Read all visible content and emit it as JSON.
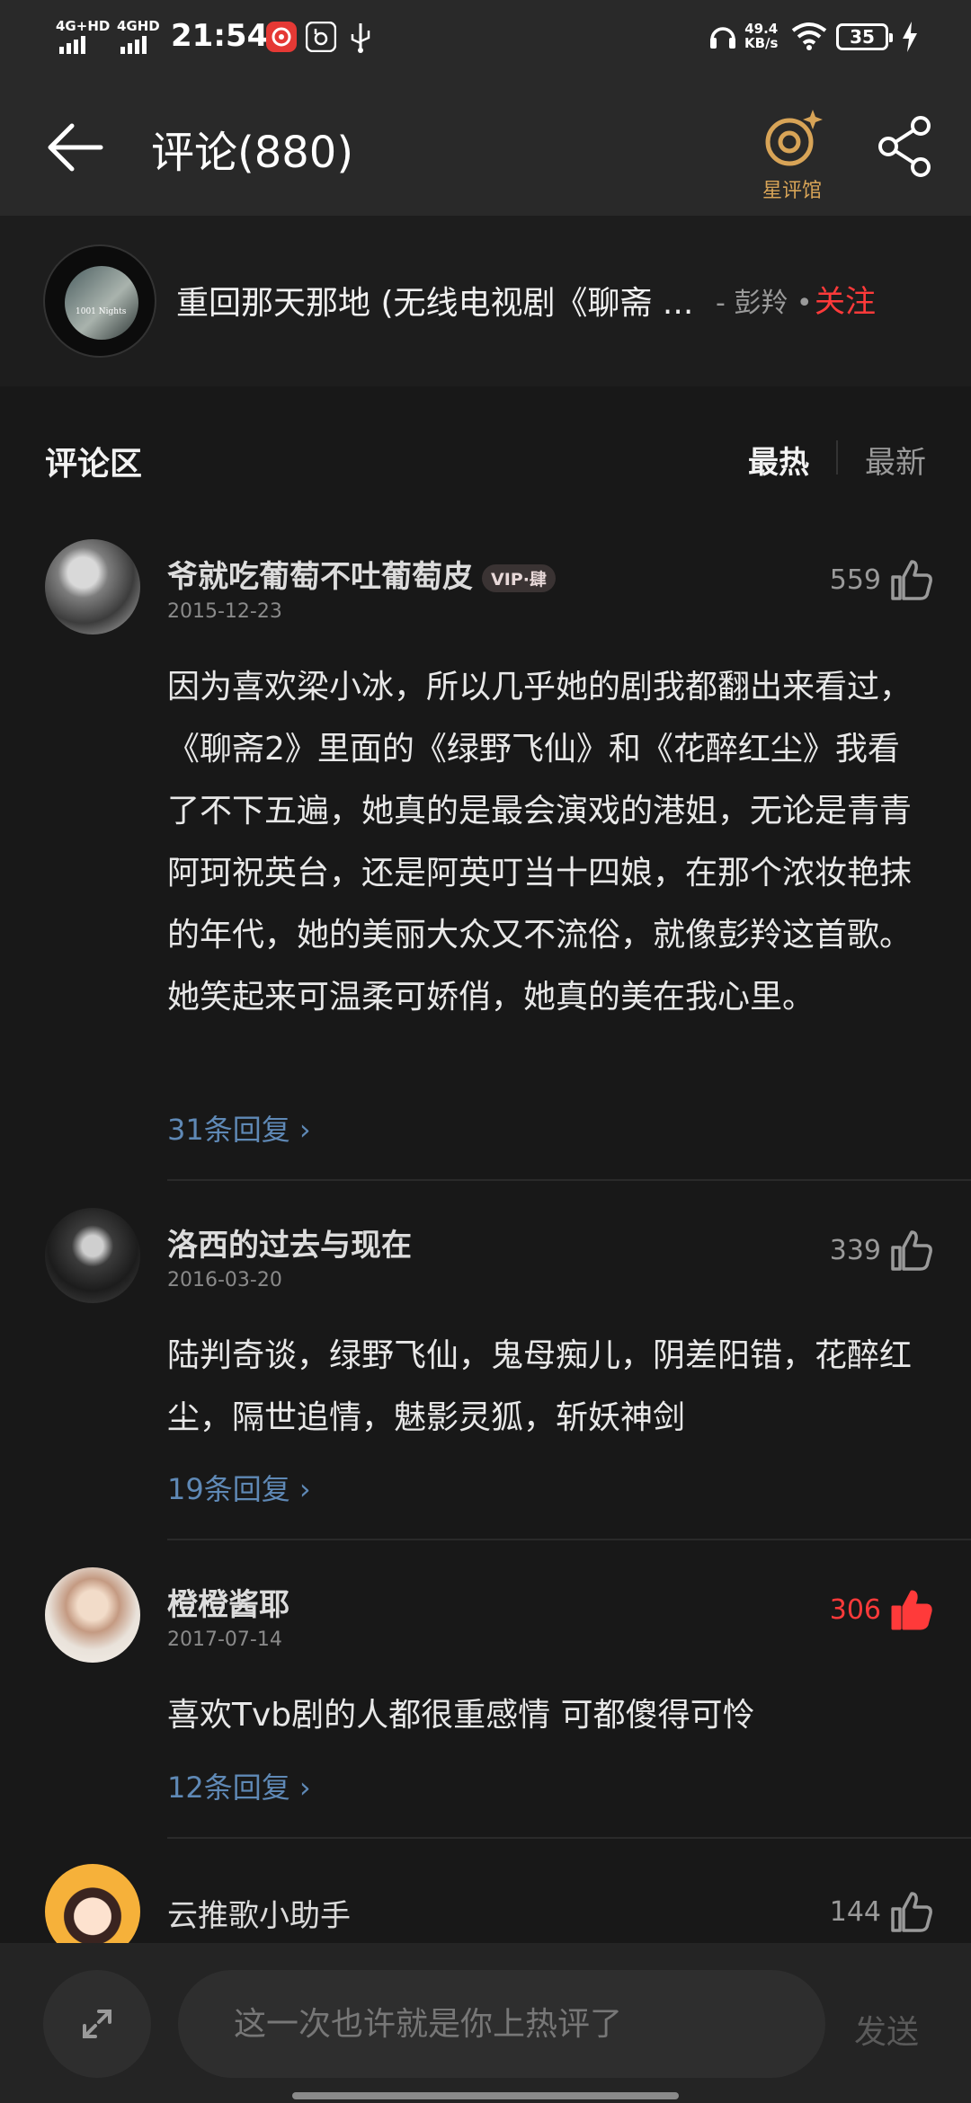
{
  "status_bar": {
    "sim1": "4G+HD",
    "sim2": "4GHD",
    "time": "21:54",
    "net_speed_value": "49.4",
    "net_speed_unit": "KB/s",
    "battery": "35"
  },
  "header": {
    "title": "评论(880)",
    "star_review_label": "星评馆"
  },
  "song": {
    "cover_text": "1001 Nights",
    "name": "重回那天那地 (无线电视剧《聊斋 ...",
    "artist_sep": "- ",
    "artist": "彭羚",
    "dot": " •",
    "follow_label": "关注"
  },
  "comments_section": {
    "title": "评论区",
    "sort_hot": "最热",
    "sort_new": "最新"
  },
  "comments": [
    {
      "user": "爷就吃葡萄不吐葡萄皮",
      "badge": "VIP·肆",
      "date": "2015-12-23",
      "likes": "559",
      "liked": false,
      "text": "因为喜欢梁小冰，所以几乎她的剧我都翻出来看过，《聊斋2》里面的《绿野飞仙》和《花醉红尘》我看了不下五遍，她真的是最会演戏的港姐，无论是青青阿珂祝英台，还是阿英叮当十四娘，在那个浓妆艳抹的年代，她的美丽大众又不流俗，就像彭羚这首歌。她笑起来可温柔可娇俏，她真的美在我心里。",
      "replies": "31条回复"
    },
    {
      "user": "洛西的过去与现在",
      "date": "2016-03-20",
      "likes": "339",
      "liked": false,
      "text": "陆判奇谈，绿野飞仙，鬼母痴儿，阴差阳错，花醉红尘，隔世追情，魅影灵狐，斩妖神剑",
      "replies": "19条回复"
    },
    {
      "user": "橙橙酱耶",
      "date": "2017-07-14",
      "likes": "306",
      "liked": true,
      "text": "喜欢Tvb剧的人都很重感情 可都傻得可怜",
      "replies": "12条回复"
    },
    {
      "user": "云推歌小助手",
      "likes": "144",
      "liked": false
    }
  ],
  "composer": {
    "placeholder": "这一次也许就是你上热评了",
    "send_label": "发送"
  },
  "colors": {
    "accent_red": "#ff3a3a",
    "reply_blue": "#5f89b6",
    "star_gold": "#d8a457"
  }
}
